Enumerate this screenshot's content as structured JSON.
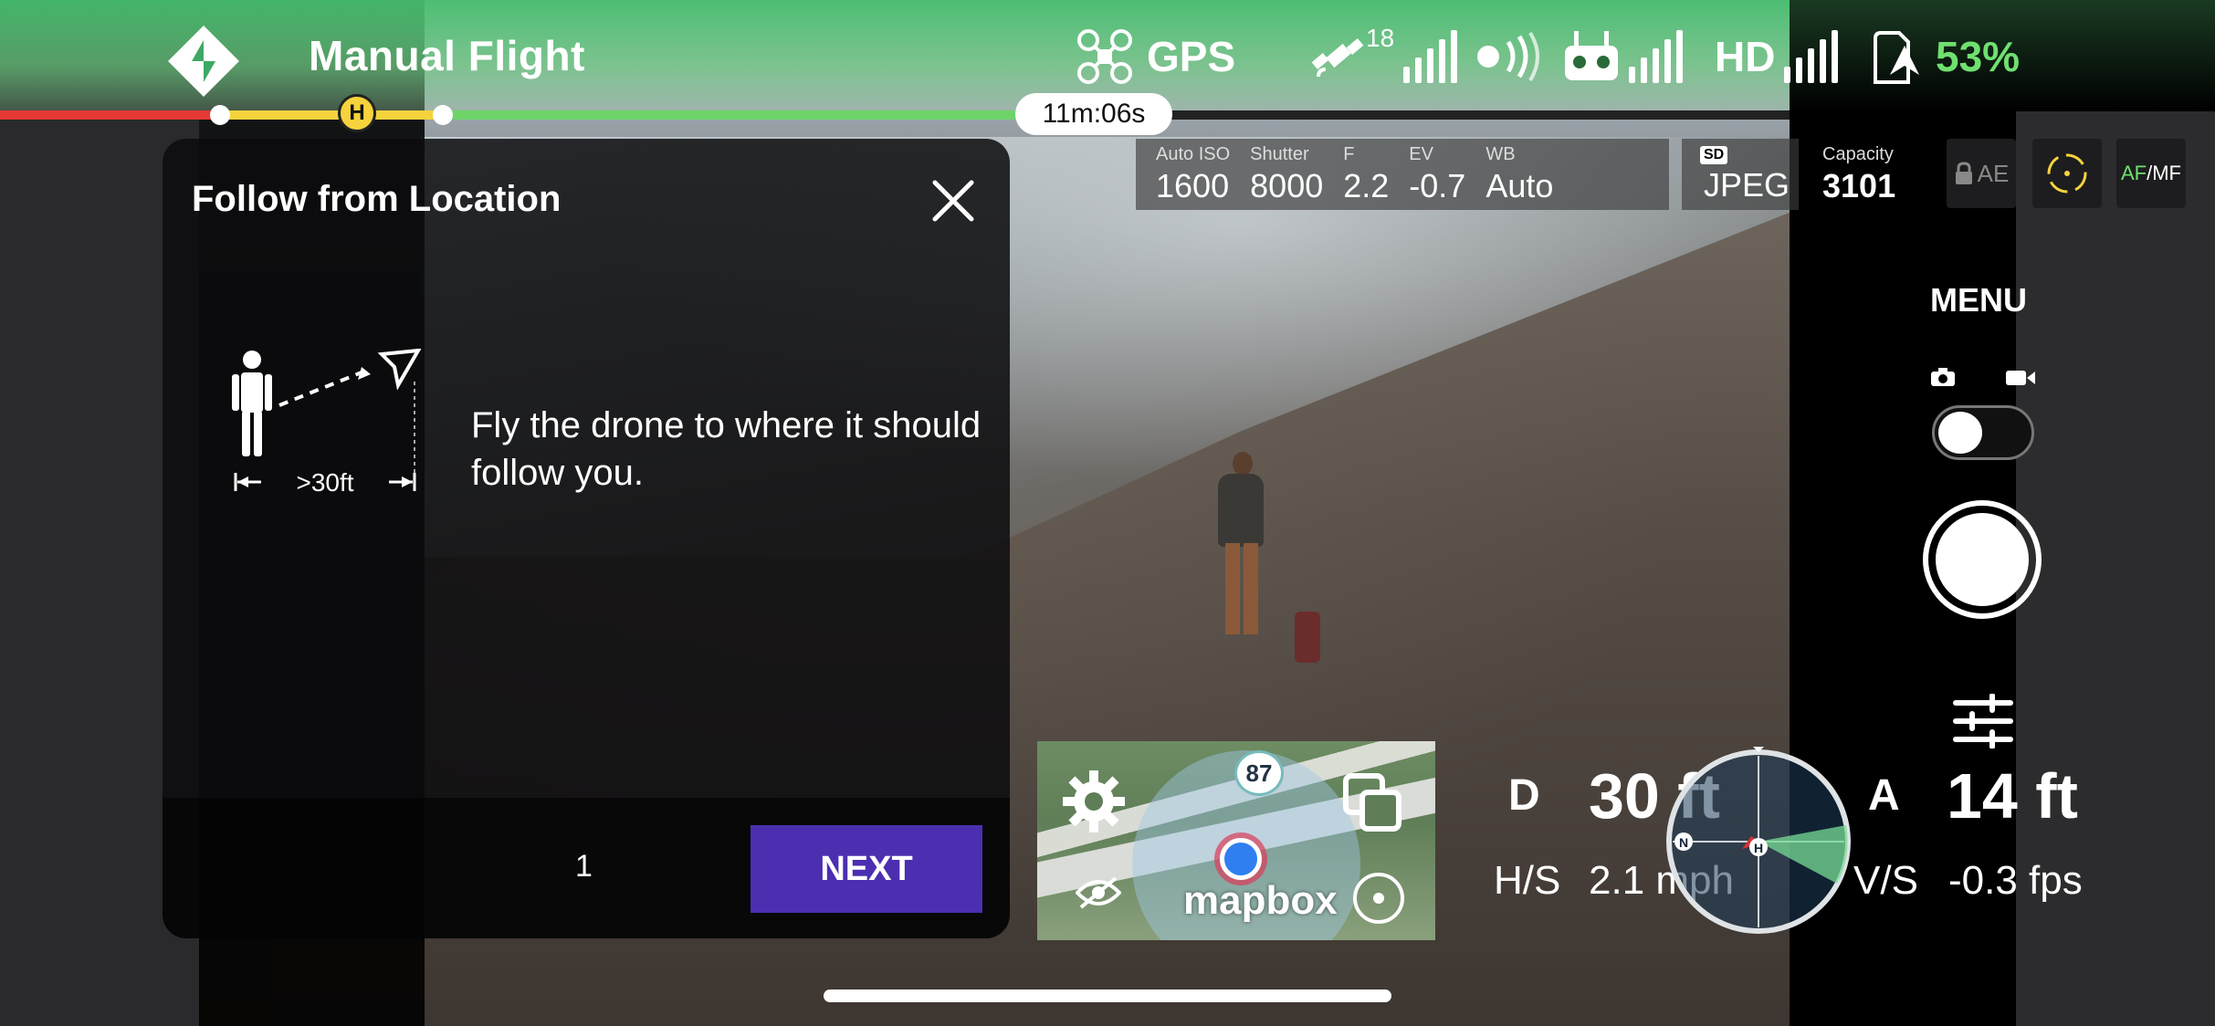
{
  "topbar": {
    "mode_title": "Manual Flight",
    "gps_label": "GPS",
    "satellite_count": "18",
    "video_quality": "HD",
    "battery_percent": "53%",
    "flight_time": "11m:06s",
    "home_marker": "H",
    "accent_color": "#6fe06f"
  },
  "camera": {
    "iso_label": "Auto ISO",
    "iso_value": "1600",
    "shutter_label": "Shutter",
    "shutter_value": "8000",
    "f_label": "F",
    "f_value": "2.2",
    "ev_label": "EV",
    "ev_value": "-0.7",
    "wb_label": "WB",
    "wb_value": "Auto",
    "storage_badge": "SD",
    "format_value": "JPEG",
    "capacity_label": "Capacity",
    "capacity_value": "3101",
    "ae_label": "AE",
    "af_label": "AF",
    "mf_label": "/MF"
  },
  "controls": {
    "menu_label": "MENU"
  },
  "telemetry": {
    "distance_label": "D",
    "distance_value": "30 ft",
    "altitude_label": "A",
    "altitude_value": "14 ft",
    "hs_label": "H/S",
    "hs_value": "2.1 mph",
    "vs_label": "V/S",
    "vs_value": "-0.3 fps",
    "compass_north": "N",
    "compass_home": "H"
  },
  "map": {
    "badge": "87",
    "attribution": "mapbox"
  },
  "dialog": {
    "title": "Follow from Location",
    "instruction": "Fly the drone to where it should follow you.",
    "distance_hint": ">30ft",
    "step": "1",
    "next_label": "NEXT",
    "button_color": "#4b2fb0"
  }
}
